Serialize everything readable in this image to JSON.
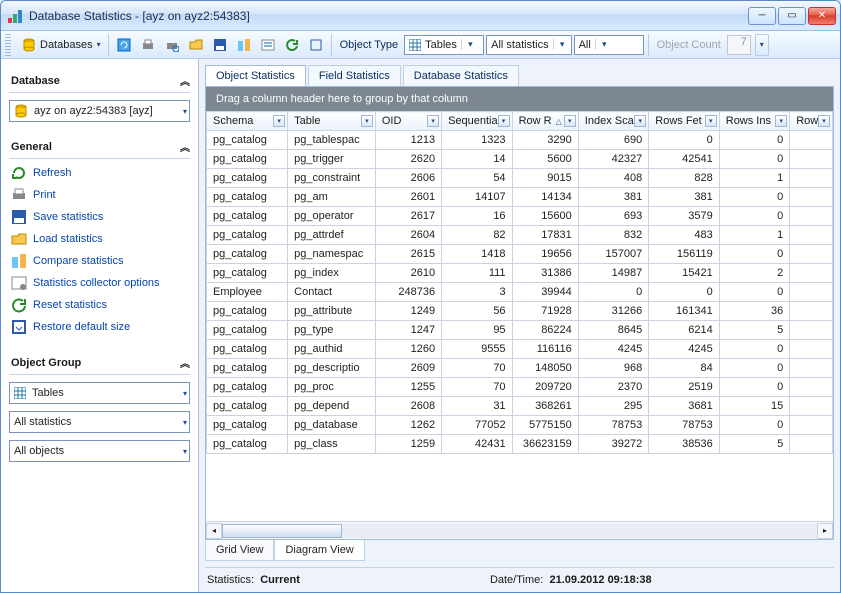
{
  "window": {
    "title": "Database Statistics - [ayz on ayz2:54383]"
  },
  "toolbar": {
    "databases_label": "Databases",
    "object_type_label": "Object Type",
    "object_type_value": "Tables",
    "filter1": "All statistics",
    "filter2": "All",
    "object_count_label": "Object Count",
    "object_count_value": "7"
  },
  "sidebar": {
    "database_heading": "Database",
    "database_combo": "ayz on ayz2:54383 [ayz]",
    "general_heading": "General",
    "links": [
      {
        "k": "refresh",
        "label": "Refresh"
      },
      {
        "k": "print",
        "label": "Print"
      },
      {
        "k": "save",
        "label": "Save statistics"
      },
      {
        "k": "load",
        "label": "Load statistics"
      },
      {
        "k": "compare",
        "label": "Compare statistics"
      },
      {
        "k": "collector",
        "label": "Statistics collector options"
      },
      {
        "k": "reset",
        "label": "Reset statistics"
      },
      {
        "k": "restore",
        "label": "Restore default size"
      }
    ],
    "object_group_heading": "Object Group",
    "og1": "Tables",
    "og2": "All statistics",
    "og3": "All objects"
  },
  "tabs": {
    "object": "Object Statistics",
    "field": "Field Statistics",
    "db": "Database Statistics"
  },
  "grid": {
    "group_prompt": "Drag a column header here to group by that column",
    "columns": [
      "Schema",
      "Table",
      "OID",
      "Sequentia",
      "Row R",
      "Index Sca",
      "Rows Fet",
      "Rows Ins",
      "Row"
    ],
    "rows": [
      [
        "pg_catalog",
        "pg_tablespac",
        "1213",
        "1323",
        "3290",
        "690",
        "0",
        "0"
      ],
      [
        "pg_catalog",
        "pg_trigger",
        "2620",
        "14",
        "5600",
        "42327",
        "42541",
        "0"
      ],
      [
        "pg_catalog",
        "pg_constraint",
        "2606",
        "54",
        "9015",
        "408",
        "828",
        "1"
      ],
      [
        "pg_catalog",
        "pg_am",
        "2601",
        "14107",
        "14134",
        "381",
        "381",
        "0"
      ],
      [
        "pg_catalog",
        "pg_operator",
        "2617",
        "16",
        "15600",
        "693",
        "3579",
        "0"
      ],
      [
        "pg_catalog",
        "pg_attrdef",
        "2604",
        "82",
        "17831",
        "832",
        "483",
        "1"
      ],
      [
        "pg_catalog",
        "pg_namespac",
        "2615",
        "1418",
        "19656",
        "157007",
        "156119",
        "0"
      ],
      [
        "pg_catalog",
        "pg_index",
        "2610",
        "111",
        "31386",
        "14987",
        "15421",
        "2"
      ],
      [
        "Employee",
        "Contact",
        "248736",
        "3",
        "39944",
        "0",
        "0",
        "0"
      ],
      [
        "pg_catalog",
        "pg_attribute",
        "1249",
        "56",
        "71928",
        "31266",
        "161341",
        "36"
      ],
      [
        "pg_catalog",
        "pg_type",
        "1247",
        "95",
        "86224",
        "8645",
        "6214",
        "5"
      ],
      [
        "pg_catalog",
        "pg_authid",
        "1260",
        "9555",
        "116116",
        "4245",
        "4245",
        "0"
      ],
      [
        "pg_catalog",
        "pg_descriptio",
        "2609",
        "70",
        "148050",
        "968",
        "84",
        "0"
      ],
      [
        "pg_catalog",
        "pg_proc",
        "1255",
        "70",
        "209720",
        "2370",
        "2519",
        "0"
      ],
      [
        "pg_catalog",
        "pg_depend",
        "2608",
        "31",
        "368261",
        "295",
        "3681",
        "15"
      ],
      [
        "pg_catalog",
        "pg_database",
        "1262",
        "77052",
        "5775150",
        "78753",
        "78753",
        "0"
      ],
      [
        "pg_catalog",
        "pg_class",
        "1259",
        "42431",
        "36623159",
        "39272",
        "38536",
        "5"
      ]
    ],
    "view_grid": "Grid View",
    "view_diagram": "Diagram View"
  },
  "status": {
    "stats_label": "Statistics:",
    "stats_value": "Current",
    "dt_label": "Date/Time:",
    "dt_value": "21.09.2012  09:18:38"
  }
}
